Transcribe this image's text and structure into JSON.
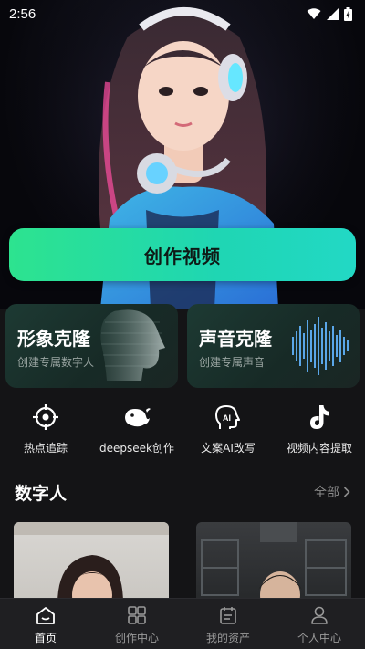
{
  "status_bar": {
    "time": "2:56"
  },
  "hero": {
    "create_button_label": "创作视频"
  },
  "features": [
    {
      "title": "形象克隆",
      "subtitle": "创建专属数字人"
    },
    {
      "title": "声音克隆",
      "subtitle": "创建专属声音"
    }
  ],
  "tools": [
    {
      "label": "热点追踪",
      "icon": "crosshair-icon"
    },
    {
      "label": "deepseek创作",
      "icon": "whale-icon"
    },
    {
      "label": "文案AI改写",
      "icon": "ai-head-icon"
    },
    {
      "label": "视频内容提取",
      "icon": "tiktok-icon"
    }
  ],
  "section": {
    "title": "数字人",
    "see_all": "全部"
  },
  "nav": [
    {
      "label": "首页",
      "icon": "home-icon",
      "active": true
    },
    {
      "label": "创作中心",
      "icon": "grid-icon",
      "active": false
    },
    {
      "label": "我的资产",
      "icon": "calendar-icon",
      "active": false
    },
    {
      "label": "个人中心",
      "icon": "person-icon",
      "active": false
    }
  ],
  "colors": {
    "accent": "#2de38f",
    "background": "#141416",
    "card": "#1d3a33"
  }
}
